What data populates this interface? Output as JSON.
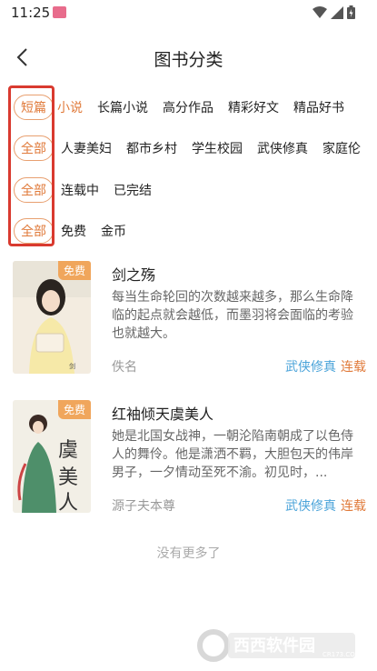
{
  "status_bar": {
    "time": "11:25"
  },
  "header": {
    "title": "图书分类"
  },
  "filters": {
    "length": {
      "active": "短篇",
      "options": [
        "长篇小说",
        "高分作品",
        "精彩好文",
        "精品好书"
      ]
    },
    "genre": {
      "active": "全部",
      "options": [
        "人妻美妇",
        "都市乡村",
        "学生校园",
        "武侠修真",
        "家庭伦"
      ]
    },
    "status": {
      "active": "全部",
      "options": [
        "连载中",
        "已完结"
      ]
    },
    "price": {
      "active": "全部",
      "options": [
        "免费",
        "金币"
      ]
    }
  },
  "books": [
    {
      "badge": "免费",
      "title": "剑之殇",
      "description": "每当生命轮回的次数越来越多，那么生命降临的起点就会越低，而墨羽将会面临的考验也就越大。",
      "author": "佚名",
      "category": "武侠修真",
      "status": "连载"
    },
    {
      "badge": "免费",
      "title": "红袖倾天虞美人",
      "description": "她是北国女战神，一朝沦陷南朝成了以色侍人的舞伶。他是潇洒不羁，大胆包天的伟岸男子，一夕情动至死不渝。初见时，...",
      "author": "源子夫本尊",
      "category": "武侠修真",
      "status": "连载"
    }
  ],
  "footer": {
    "end_note": "没有更多了"
  },
  "watermark": {
    "brand": "西西软件园",
    "site": "CR173.COM"
  },
  "colors": {
    "accent_orange": "#e07a3a",
    "category_blue": "#4aa3d9",
    "highlight_red": "#d93a2f"
  }
}
